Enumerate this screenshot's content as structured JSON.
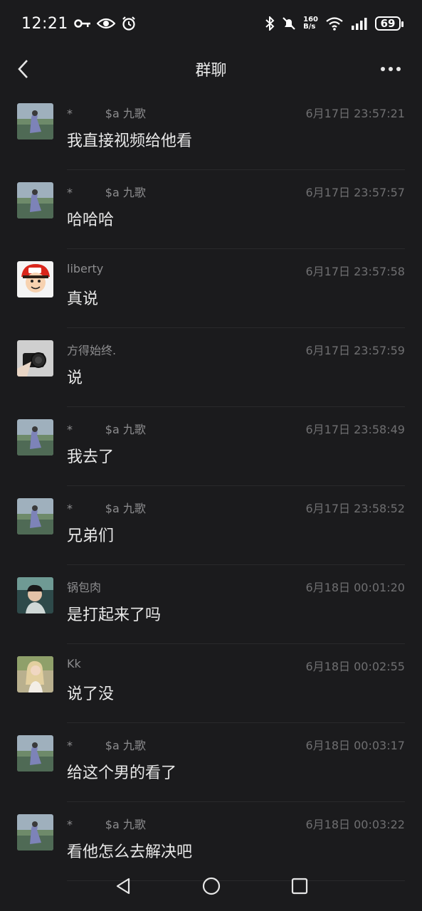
{
  "status_bar": {
    "time": "12:21",
    "net_speed_value": "160",
    "net_speed_unit": "B/s",
    "battery": "69"
  },
  "header": {
    "title": "群聊"
  },
  "messages": [
    {
      "name": "*         $a 九歌",
      "time": "6月17日 23:57:21",
      "text": "我直接视频给他看",
      "avatar": "avatar-landscape"
    },
    {
      "name": "*         $a 九歌",
      "time": "6月17日 23:57:57",
      "text": "哈哈哈",
      "avatar": "avatar-landscape"
    },
    {
      "name": "liberty",
      "time": "6月17日 23:57:58",
      "text": "真说",
      "avatar": "avatar-cartoon"
    },
    {
      "name": "方得始终.",
      "time": "6月17日 23:57:59",
      "text": "说",
      "avatar": "avatar-camera"
    },
    {
      "name": "*         $a 九歌",
      "time": "6月17日 23:58:49",
      "text": "我去了",
      "avatar": "avatar-landscape"
    },
    {
      "name": "*         $a 九歌",
      "time": "6月17日 23:58:52",
      "text": "兄弟们",
      "avatar": "avatar-landscape"
    },
    {
      "name": "锅包肉",
      "time": "6月18日 00:01:20",
      "text": "是打起来了吗",
      "avatar": "avatar-car"
    },
    {
      "name": "Kk",
      "time": "6月18日 00:02:55",
      "text": "说了没",
      "avatar": "avatar-girl"
    },
    {
      "name": "*         $a 九歌",
      "time": "6月18日 00:03:17",
      "text": "给这个男的看了",
      "avatar": "avatar-landscape"
    },
    {
      "name": "*         $a 九歌",
      "time": "6月18日 00:03:22",
      "text": "看他怎么去解决吧",
      "avatar": "avatar-landscape"
    }
  ],
  "colors": {
    "background": "#1b1b1d",
    "text": "#e8e8e8",
    "meta": "#8d8d8f"
  }
}
